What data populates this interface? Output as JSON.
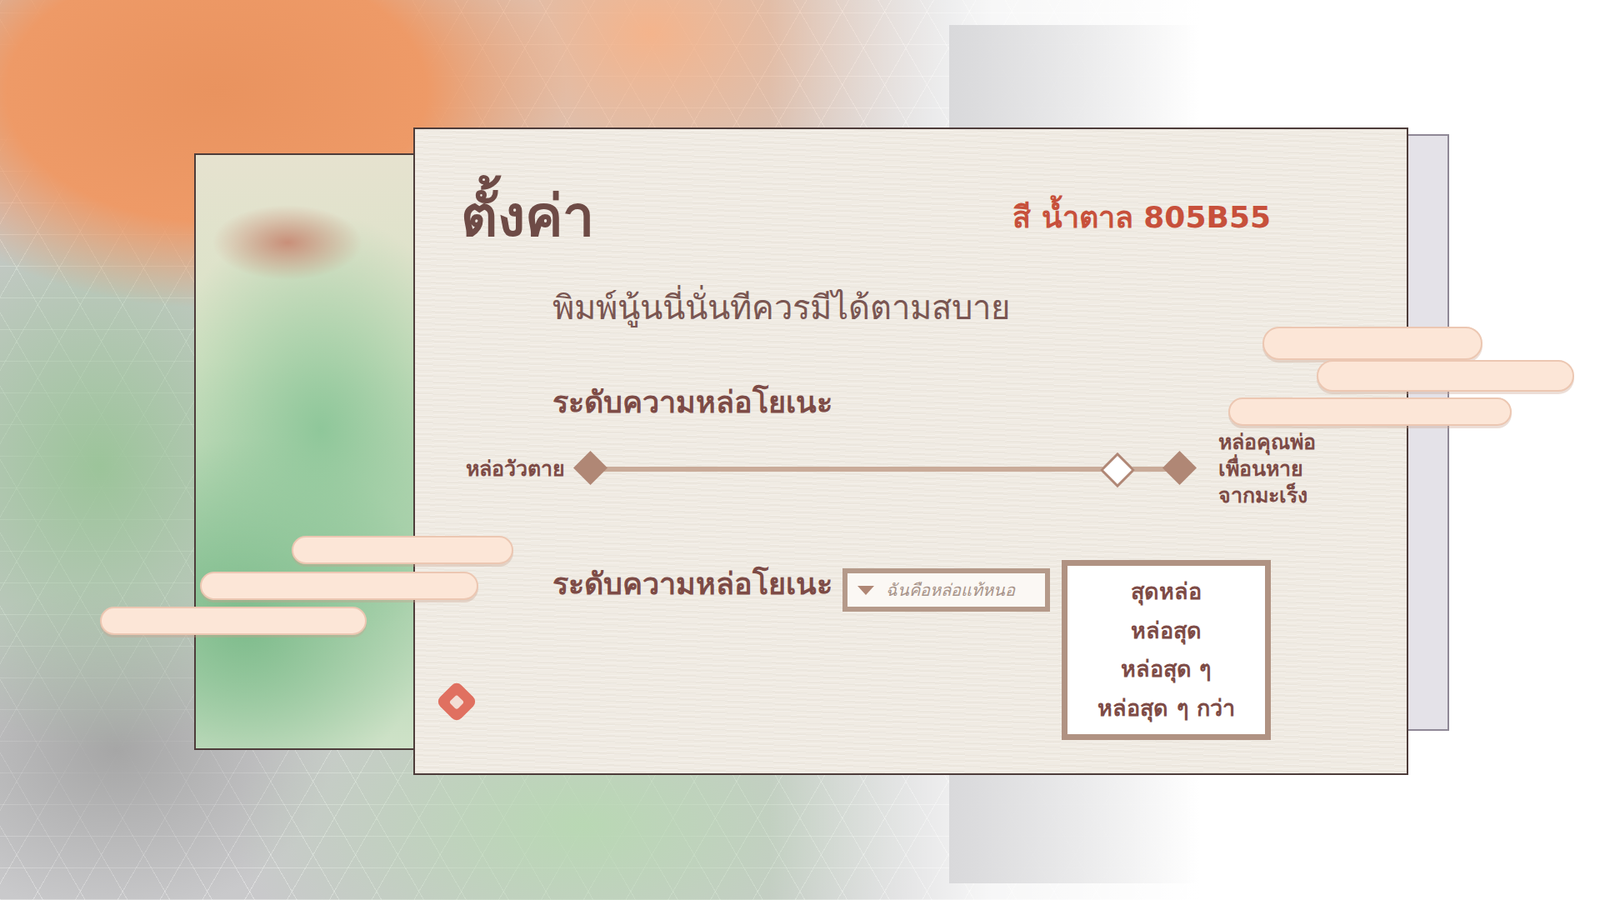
{
  "window": {
    "title": "ตั้งค่า"
  },
  "color_label": "สี น้ำตาล 805B55",
  "subtitle": "พิมพ์นู้นนี่นั่นทีควรมีได้ตามสบาย",
  "slider": {
    "label": "ระดับความหล่อโยเนะ",
    "min_label": "หล่อวัวตาย",
    "max_label": [
      "หล่อคุณพ่อ",
      "เพื่อนหาย",
      "จากมะเร็ง"
    ],
    "level": 0.89
  },
  "dropdown": {
    "label": "ระดับความหล่อโยเนะ",
    "placeholder": "ฉันคือหล่อแท้หนอ",
    "expanded": true,
    "options": [
      {
        "label": "สุดหล่อ",
        "selected": false
      },
      {
        "label": "หล่อสุด",
        "selected": false
      },
      {
        "label": "หล่อสุด ๆ",
        "selected": false
      },
      {
        "label": "หล่อสุด ๆ กว่า",
        "selected": false
      }
    ]
  }
}
